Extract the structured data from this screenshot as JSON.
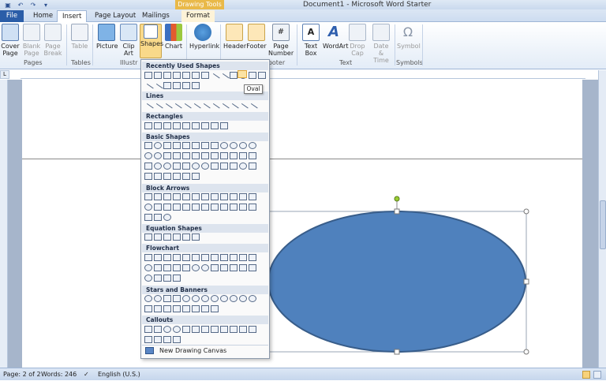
{
  "window": {
    "title": "Document1 - Microsoft Word Starter",
    "context_tab": "Drawing Tools"
  },
  "qat": {
    "icons": [
      "save-icon",
      "undo-icon",
      "redo-icon",
      "customize-icon"
    ]
  },
  "tabs": {
    "file": "File",
    "home": "Home",
    "insert": "Insert",
    "page_layout": "Page Layout",
    "mailings": "Mailings",
    "format": "Format"
  },
  "ribbon": {
    "cover_page": "Cover Page",
    "blank_page": "Blank Page",
    "page_break": "Page Break",
    "table": "Table",
    "picture": "Picture",
    "clip_art": "Clip Art",
    "shapes": "Shapes",
    "chart": "Chart",
    "hyperlink": "Hyperlink",
    "header": "Header",
    "footer": "Footer",
    "page_number": "Page Number",
    "text_box": "Text Box",
    "wordart": "WordArt",
    "drop_cap": "Drop Cap",
    "date_time": "Date & Time",
    "symbol": "Symbol",
    "groups": {
      "pages": "Pages",
      "tables": "Tables",
      "illustrations": "Illustr",
      "header_footer": "ooter",
      "text": "Text",
      "symbols": "Symbols"
    }
  },
  "ruler": {
    "corner": "L"
  },
  "shapes_menu": {
    "sections": [
      "Recently Used Shapes",
      "Lines",
      "Rectangles",
      "Basic Shapes",
      "Block Arrows",
      "Equation Shapes",
      "Flowchart",
      "Stars and Banners",
      "Callouts"
    ],
    "tooltip": "Oval",
    "new_canvas": "New Drawing Canvas"
  },
  "status": {
    "page": "Page: 2 of 2",
    "words": "Words: 246",
    "language": "English (U.S.)"
  },
  "colors": {
    "oval_fill": "#4f81bd",
    "oval_stroke": "#385d8a",
    "handle_green": "#9acd32"
  }
}
